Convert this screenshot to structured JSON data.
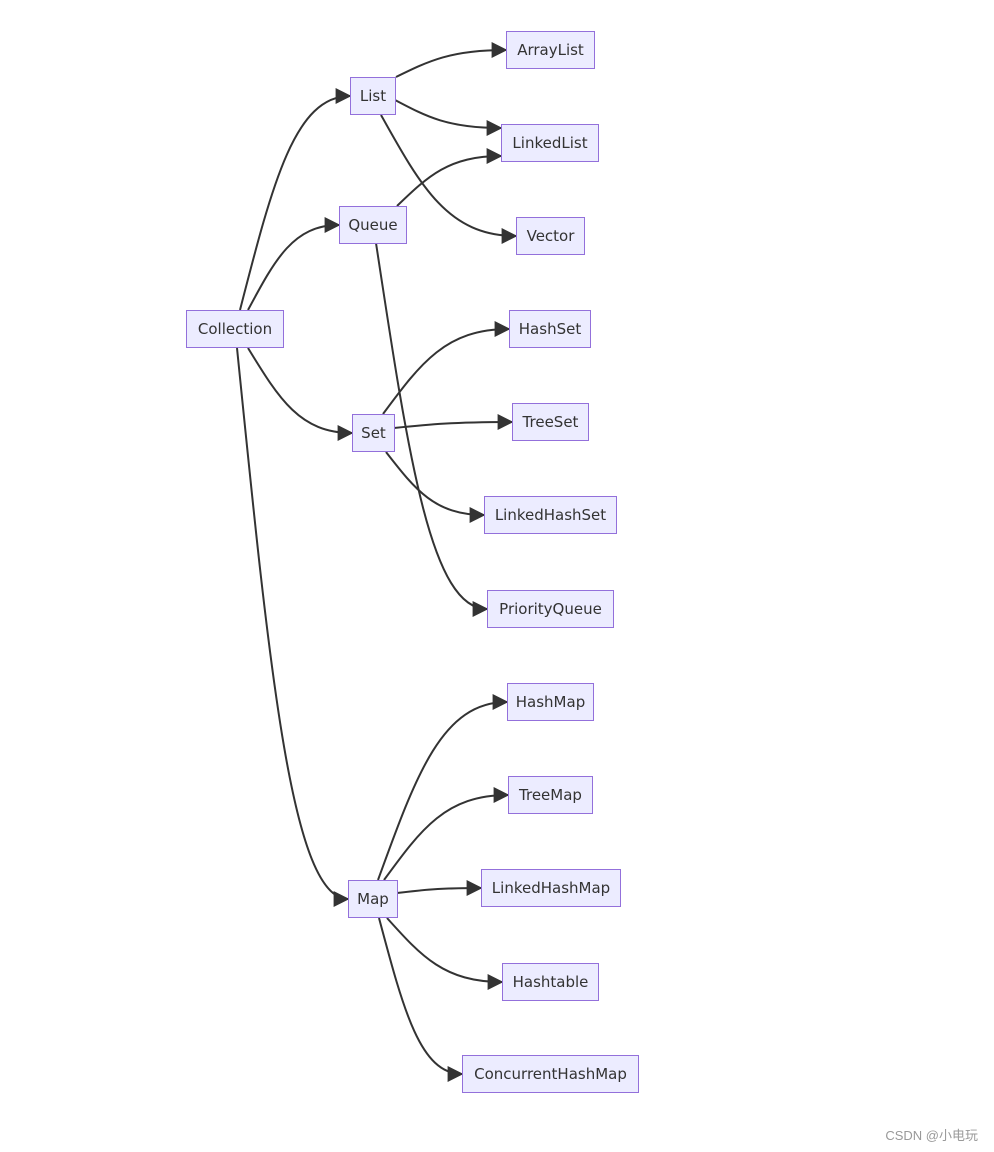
{
  "colors": {
    "node_fill": "#ECECFF",
    "node_border": "#9370DB",
    "edge": "#333333",
    "text": "#333333"
  },
  "nodes": [
    {
      "id": "Collection",
      "label": "Collection"
    },
    {
      "id": "List",
      "label": "List"
    },
    {
      "id": "Queue",
      "label": "Queue"
    },
    {
      "id": "Set",
      "label": "Set"
    },
    {
      "id": "Map",
      "label": "Map"
    },
    {
      "id": "ArrayList",
      "label": "ArrayList"
    },
    {
      "id": "LinkedList",
      "label": "LinkedList"
    },
    {
      "id": "Vector",
      "label": "Vector"
    },
    {
      "id": "HashSet",
      "label": "HashSet"
    },
    {
      "id": "TreeSet",
      "label": "TreeSet"
    },
    {
      "id": "LinkedHashSet",
      "label": "LinkedHashSet"
    },
    {
      "id": "PriorityQueue",
      "label": "PriorityQueue"
    },
    {
      "id": "HashMap",
      "label": "HashMap"
    },
    {
      "id": "TreeMap",
      "label": "TreeMap"
    },
    {
      "id": "LinkedHashMap",
      "label": "LinkedHashMap"
    },
    {
      "id": "Hashtable",
      "label": "Hashtable"
    },
    {
      "id": "ConcurrentHashMap",
      "label": "ConcurrentHashMap"
    }
  ],
  "edges": [
    {
      "from": "Collection",
      "to": "List"
    },
    {
      "from": "Collection",
      "to": "Queue"
    },
    {
      "from": "Collection",
      "to": "Set"
    },
    {
      "from": "Collection",
      "to": "Map"
    },
    {
      "from": "List",
      "to": "ArrayList"
    },
    {
      "from": "List",
      "to": "LinkedList"
    },
    {
      "from": "List",
      "to": "Vector"
    },
    {
      "from": "Queue",
      "to": "LinkedList"
    },
    {
      "from": "Queue",
      "to": "PriorityQueue"
    },
    {
      "from": "Set",
      "to": "HashSet"
    },
    {
      "from": "Set",
      "to": "TreeSet"
    },
    {
      "from": "Set",
      "to": "LinkedHashSet"
    },
    {
      "from": "Map",
      "to": "HashMap"
    },
    {
      "from": "Map",
      "to": "TreeMap"
    },
    {
      "from": "Map",
      "to": "LinkedHashMap"
    },
    {
      "from": "Map",
      "to": "Hashtable"
    },
    {
      "from": "Map",
      "to": "ConcurrentHashMap"
    }
  ],
  "watermark": "CSDN @小电玩"
}
